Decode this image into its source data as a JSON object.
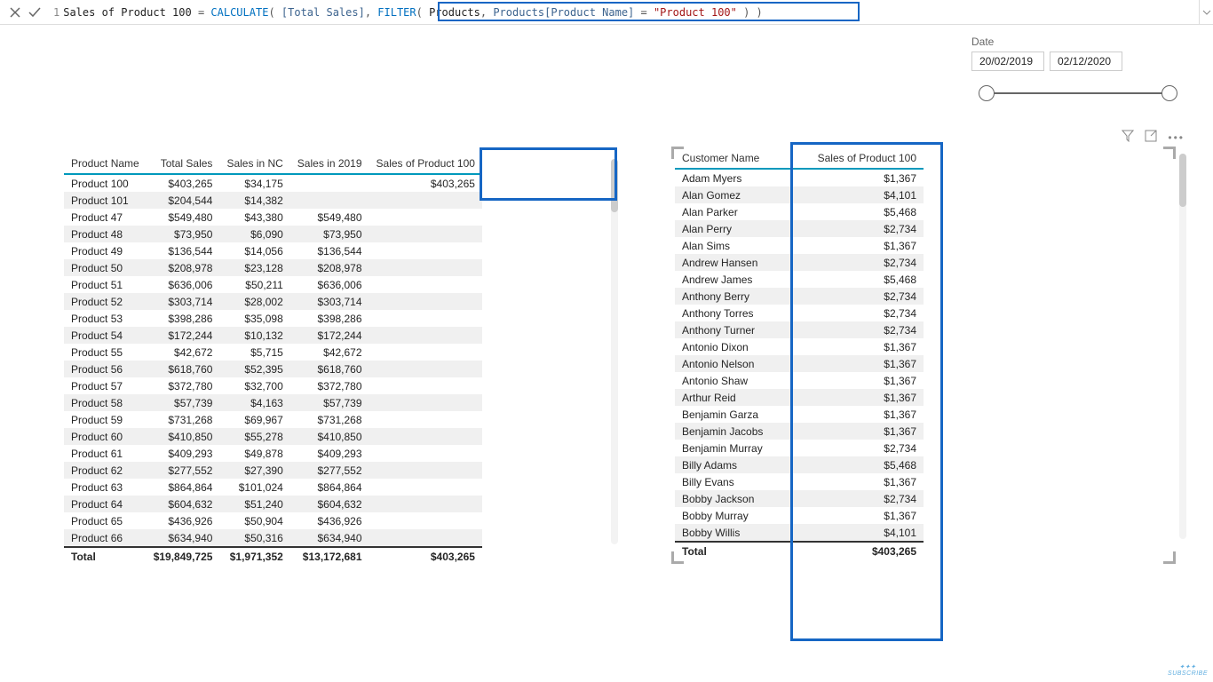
{
  "formula": {
    "lineNo": "1",
    "tokens": [
      {
        "t": "Sales of Product 100 ",
        "cls": "tok-name"
      },
      {
        "t": "= ",
        "cls": "tok-punc"
      },
      {
        "t": "CALCULATE",
        "cls": "tok-func"
      },
      {
        "t": "( ",
        "cls": "tok-punc"
      },
      {
        "t": "[Total Sales]",
        "cls": "tok-col"
      },
      {
        "t": ", ",
        "cls": "tok-punc"
      },
      {
        "t": "FILTER",
        "cls": "tok-func"
      },
      {
        "t": "( ",
        "cls": "tok-punc"
      },
      {
        "t": "Products",
        "cls": "tok-name"
      },
      {
        "t": ", ",
        "cls": "tok-punc"
      },
      {
        "t": "Products[Product Name] ",
        "cls": "tok-col"
      },
      {
        "t": "= ",
        "cls": "tok-punc"
      },
      {
        "t": "\"Product 100\"",
        "cls": "tok-str"
      },
      {
        "t": " ) )",
        "cls": "tok-punc"
      }
    ]
  },
  "slicer": {
    "title": "Date",
    "start": "20/02/2019",
    "end": "02/12/2020"
  },
  "table1": {
    "headers": [
      "Product Name",
      "Total Sales",
      "Sales in NC",
      "Sales in 2019",
      "Sales of Product 100"
    ],
    "colTypes": [
      "text",
      "num",
      "num",
      "num",
      "num"
    ],
    "rows": [
      [
        "Product 100",
        "$403,265",
        "$34,175",
        "",
        "$403,265"
      ],
      [
        "Product 101",
        "$204,544",
        "$14,382",
        "",
        ""
      ],
      [
        "Product 47",
        "$549,480",
        "$43,380",
        "$549,480",
        ""
      ],
      [
        "Product 48",
        "$73,950",
        "$6,090",
        "$73,950",
        ""
      ],
      [
        "Product 49",
        "$136,544",
        "$14,056",
        "$136,544",
        ""
      ],
      [
        "Product 50",
        "$208,978",
        "$23,128",
        "$208,978",
        ""
      ],
      [
        "Product 51",
        "$636,006",
        "$50,211",
        "$636,006",
        ""
      ],
      [
        "Product 52",
        "$303,714",
        "$28,002",
        "$303,714",
        ""
      ],
      [
        "Product 53",
        "$398,286",
        "$35,098",
        "$398,286",
        ""
      ],
      [
        "Product 54",
        "$172,244",
        "$10,132",
        "$172,244",
        ""
      ],
      [
        "Product 55",
        "$42,672",
        "$5,715",
        "$42,672",
        ""
      ],
      [
        "Product 56",
        "$618,760",
        "$52,395",
        "$618,760",
        ""
      ],
      [
        "Product 57",
        "$372,780",
        "$32,700",
        "$372,780",
        ""
      ],
      [
        "Product 58",
        "$57,739",
        "$4,163",
        "$57,739",
        ""
      ],
      [
        "Product 59",
        "$731,268",
        "$69,967",
        "$731,268",
        ""
      ],
      [
        "Product 60",
        "$410,850",
        "$55,278",
        "$410,850",
        ""
      ],
      [
        "Product 61",
        "$409,293",
        "$49,878",
        "$409,293",
        ""
      ],
      [
        "Product 62",
        "$277,552",
        "$27,390",
        "$277,552",
        ""
      ],
      [
        "Product 63",
        "$864,864",
        "$101,024",
        "$864,864",
        ""
      ],
      [
        "Product 64",
        "$604,632",
        "$51,240",
        "$604,632",
        ""
      ],
      [
        "Product 65",
        "$436,926",
        "$50,904",
        "$436,926",
        ""
      ],
      [
        "Product 66",
        "$634,940",
        "$50,316",
        "$634,940",
        ""
      ]
    ],
    "totalLabel": "Total",
    "totals": [
      "$19,849,725",
      "$1,971,352",
      "$13,172,681",
      "$403,265"
    ]
  },
  "table2": {
    "headers": [
      "Customer Name",
      "Sales of Product 100"
    ],
    "colTypes": [
      "text",
      "num"
    ],
    "colWidths": [
      "130px",
      "150px"
    ],
    "rows": [
      [
        "Adam Myers",
        "$1,367"
      ],
      [
        "Alan Gomez",
        "$4,101"
      ],
      [
        "Alan Parker",
        "$5,468"
      ],
      [
        "Alan Perry",
        "$2,734"
      ],
      [
        "Alan Sims",
        "$1,367"
      ],
      [
        "Andrew Hansen",
        "$2,734"
      ],
      [
        "Andrew James",
        "$5,468"
      ],
      [
        "Anthony Berry",
        "$2,734"
      ],
      [
        "Anthony Torres",
        "$2,734"
      ],
      [
        "Anthony Turner",
        "$2,734"
      ],
      [
        "Antonio Dixon",
        "$1,367"
      ],
      [
        "Antonio Nelson",
        "$1,367"
      ],
      [
        "Antonio Shaw",
        "$1,367"
      ],
      [
        "Arthur Reid",
        "$1,367"
      ],
      [
        "Benjamin Garza",
        "$1,367"
      ],
      [
        "Benjamin Jacobs",
        "$1,367"
      ],
      [
        "Benjamin Murray",
        "$2,734"
      ],
      [
        "Billy Adams",
        "$5,468"
      ],
      [
        "Billy Evans",
        "$1,367"
      ],
      [
        "Bobby Jackson",
        "$2,734"
      ],
      [
        "Bobby Murray",
        "$1,367"
      ],
      [
        "Bobby Willis",
        "$4,101"
      ]
    ],
    "totalLabel": "Total",
    "totals": [
      "$403,265"
    ]
  },
  "watermark": "SUBSCRIBE"
}
